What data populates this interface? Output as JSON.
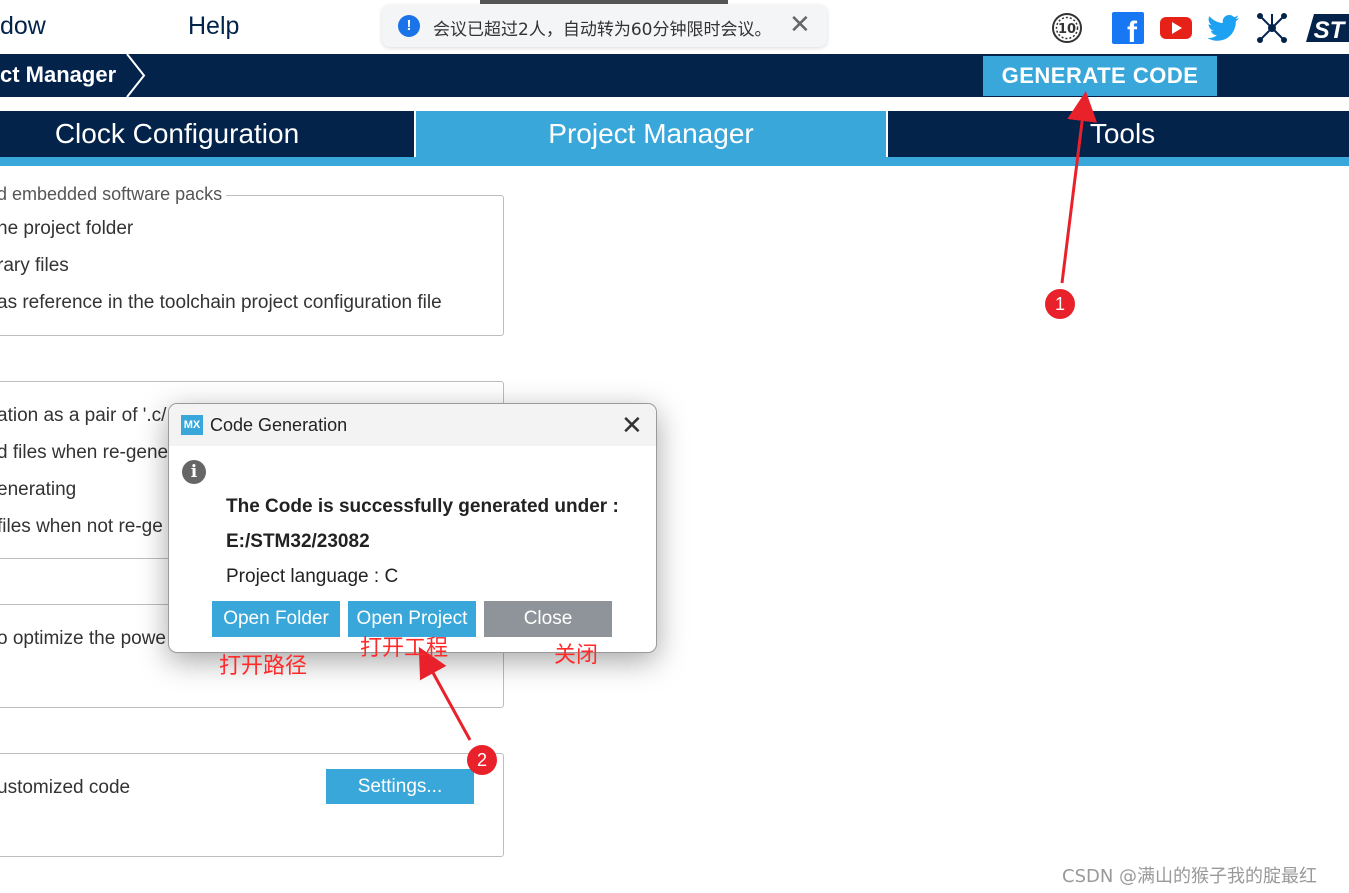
{
  "menubar": {
    "window_label": "dow",
    "help_label": "Help"
  },
  "toast": {
    "message": "会议已超过2人，自动转为60分钟限时会议。",
    "close": "✕"
  },
  "header_icons": {
    "anniversary": "10",
    "facebook": "f",
    "st_logo": "ST"
  },
  "navbar": {
    "breadcrumb": "ct Manager",
    "generate_label": "GENERATE CODE"
  },
  "tabs": [
    {
      "label": "Clock Configuration"
    },
    {
      "label": "Project Manager"
    },
    {
      "label": "Tools"
    }
  ],
  "groups": {
    "packs": {
      "legend": "d embedded software packs",
      "options": [
        "he project folder",
        "rary files",
        "as reference in the toolchain project configuration file"
      ]
    },
    "generated_files": {
      "options": [
        "ation as a pair of '.c/",
        "d files when re-gene",
        "enerating",
        " files when not re-ge"
      ]
    },
    "hal": {
      "options": [
        "o optimize the powe"
      ]
    },
    "user": {
      "options": [
        "ustomized code"
      ],
      "settings_label": "Settings..."
    }
  },
  "dialog": {
    "logo": "MX",
    "title": "Code Generation",
    "close": "✕",
    "info_icon": "i",
    "line1": "The Code is successfully generated under :",
    "line2": "E:/STM32/23082",
    "line3": "Project language : C",
    "buttons": {
      "open_folder": "Open Folder",
      "open_project": "Open Project",
      "close": "Close"
    }
  },
  "annotations": {
    "open_folder": "打开路径",
    "open_project": "打开工程",
    "close": "关闭",
    "badge1": "1",
    "badge2": "2"
  },
  "colors": {
    "navy": "#03234b",
    "accent": "#3aa7db",
    "close_btn": "#8e9499",
    "annotation": "#ff2a2a"
  },
  "watermark": "CSDN @满山的猴子我的腚最红"
}
